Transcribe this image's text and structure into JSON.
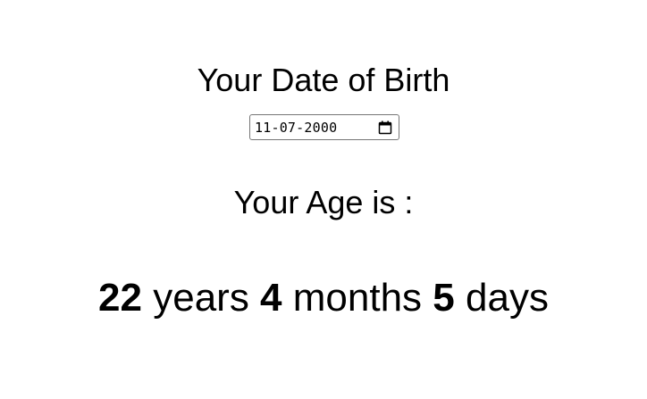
{
  "dob_section": {
    "heading": "Your Date of Birth",
    "date_input": {
      "value": "11-07-2000"
    }
  },
  "age_section": {
    "heading": "Your Age is :",
    "result": {
      "years_value": "22",
      "years_unit": "years",
      "months_value": "4",
      "months_unit": "months",
      "days_value": "5",
      "days_unit": "days"
    }
  },
  "icons": {
    "date_picker": "calendar-icon"
  }
}
